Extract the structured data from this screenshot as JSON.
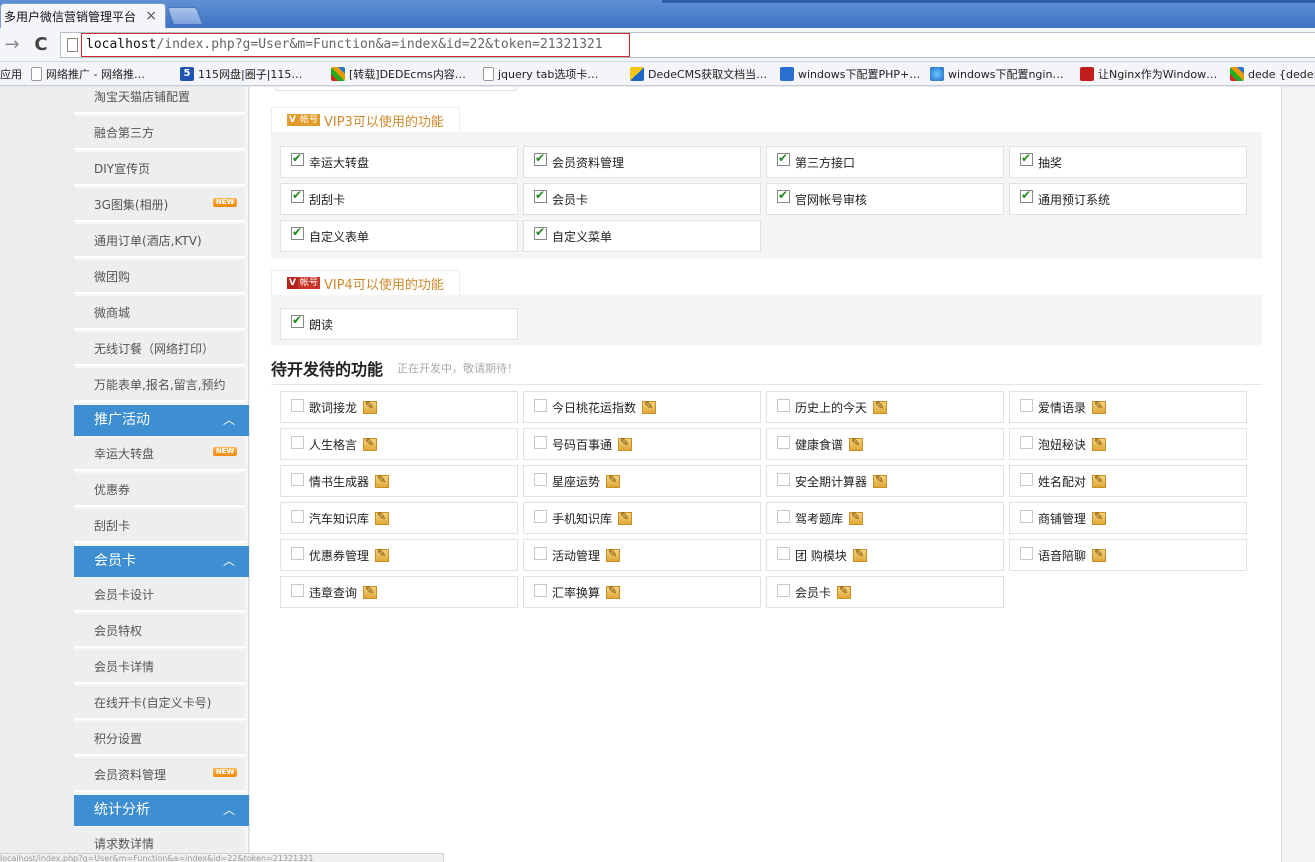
{
  "browser": {
    "tab_title": "多用户微信营销管理平台",
    "tab_close": "×",
    "url_host": "localhost",
    "url_rest": "/index.php?g=User&m=Function&a=index&id=22&token=21321321",
    "bookmarks": [
      {
        "label": "应用",
        "icon": "apps-icon"
      },
      {
        "label": "网络推广 - 网络推…",
        "icon": "page-icon"
      },
      {
        "label": "115网盘|圈子|115…",
        "icon": "115-icon"
      },
      {
        "label": "[转载]DEDEcms内容…",
        "icon": "dede-icon"
      },
      {
        "label": "jquery tab选项卡…",
        "icon": "page-icon"
      },
      {
        "label": "DedeCMS获取文档当…",
        "icon": "dede-icon"
      },
      {
        "label": "windows下配置PHP+…",
        "icon": "blue-circle-icon"
      },
      {
        "label": "windows下配置ngin…",
        "icon": "globe-icon"
      },
      {
        "label": "让Nginx作为Window…",
        "icon": "red-icon"
      },
      {
        "label": "dede {dede:…",
        "icon": "dede-icon"
      }
    ],
    "status_url": "localhost/index.php?g=User&m=Function&a=index&id=22&token=21321321"
  },
  "sidebar": {
    "new_badge": "NEW",
    "group_a": [
      {
        "label": "淘宝天猫店铺配置",
        "new": false
      },
      {
        "label": "融合第三方",
        "new": false
      },
      {
        "label": "DIY宣传页",
        "new": false
      },
      {
        "label": "3G图集(相册)",
        "new": true
      },
      {
        "label": "通用订单(酒店,KTV)",
        "new": false
      },
      {
        "label": "微团购",
        "new": false
      },
      {
        "label": "微商城",
        "new": false
      },
      {
        "label": "无线订餐（网络打印）",
        "new": false
      },
      {
        "label": "万能表单,报名,留言,预约",
        "new": false
      }
    ],
    "cat_promo": "推广活动",
    "group_promo": [
      {
        "label": "幸运大转盘",
        "new": true
      },
      {
        "label": "优惠券",
        "new": false
      },
      {
        "label": "刮刮卡",
        "new": false
      }
    ],
    "cat_member": "会员卡",
    "group_member": [
      {
        "label": "会员卡设计",
        "new": false
      },
      {
        "label": "会员特权",
        "new": false
      },
      {
        "label": "会员卡详情",
        "new": false
      },
      {
        "label": "在线开卡(自定义卡号)",
        "new": false
      },
      {
        "label": "积分设置",
        "new": false
      },
      {
        "label": "会员资料管理",
        "new": true
      }
    ],
    "cat_stats": "统计分析",
    "group_stats": [
      {
        "label": "请求数详情",
        "new": false
      }
    ],
    "chevron": "︿"
  },
  "vip3": {
    "logo_v": "V",
    "logo_text": "帐号",
    "title": "VIP3可以使用的功能",
    "items": [
      {
        "label": "幸运大转盘",
        "checked": true
      },
      {
        "label": "会员资料管理",
        "checked": true
      },
      {
        "label": "第三方接口",
        "checked": true
      },
      {
        "label": "抽奖",
        "checked": true
      },
      {
        "label": "刮刮卡",
        "checked": true
      },
      {
        "label": "会员卡",
        "checked": true
      },
      {
        "label": "官网帐号审核",
        "checked": true
      },
      {
        "label": "通用预订系统",
        "checked": true
      },
      {
        "label": "自定义表单",
        "checked": true
      },
      {
        "label": "自定义菜单",
        "checked": true
      }
    ]
  },
  "vip4": {
    "logo_v": "V",
    "logo_text": "帐号",
    "title": "VIP4可以使用的功能",
    "items": [
      {
        "label": "朗读",
        "checked": true
      }
    ]
  },
  "pending": {
    "title": "待开发待的功能",
    "subtitle": "正在开发中，敬请期待！",
    "items": [
      "歌词接龙",
      "今日桃花运指数",
      "历史上的今天",
      "爱情语录",
      "人生格言",
      "号码百事通",
      "健康食谱",
      "泡妞秘诀",
      "情书生成器",
      "星座运势",
      "安全期计算器",
      "姓名配对",
      "汽车知识库",
      "手机知识库",
      "驾考题库",
      "商铺管理",
      "优惠券管理",
      "活动管理",
      "团 购模块",
      "语音陪聊",
      "违章查询",
      "汇率换算",
      "会员卡"
    ]
  }
}
